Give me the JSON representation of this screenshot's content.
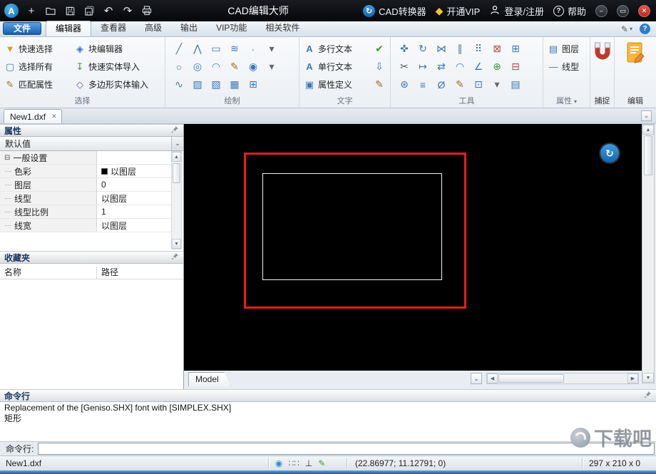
{
  "titlebar": {
    "title": "CAD编辑大师",
    "converter_label": "CAD转换器",
    "vip_label": "开通VIP",
    "login_label": "登录/注册",
    "help_label": "帮助"
  },
  "menu": {
    "file_label": "文件",
    "active_tab": "编辑器",
    "tabs": [
      {
        "name": "editor",
        "label": "编辑器"
      },
      {
        "name": "viewer",
        "label": "查看器"
      },
      {
        "name": "advanced",
        "label": "高级"
      },
      {
        "name": "output",
        "label": "输出"
      },
      {
        "name": "vip-features",
        "label": "VIP功能"
      },
      {
        "name": "related-software",
        "label": "相关软件"
      }
    ]
  },
  "ribbon": {
    "selection": {
      "label": "选择",
      "columns": [
        [
          {
            "name": "quick-select-button",
            "icon": "funnel-icon",
            "glyph": "▼",
            "color": "#d99c2b",
            "label": "快速选择"
          },
          {
            "name": "select-all-button",
            "icon": "selection-box-icon",
            "glyph": "▢",
            "color": "#3a78b5",
            "label": "选择所有"
          },
          {
            "name": "match-properties-button",
            "icon": "brush-icon",
            "glyph": "✎",
            "color": "#a06b2a",
            "label": "匹配属性"
          }
        ],
        [
          {
            "name": "block-editor-button",
            "icon": "block-icon",
            "glyph": "◈",
            "color": "#3a78b5",
            "label": "块编辑器"
          },
          {
            "name": "quick-entity-import-button",
            "icon": "import-arrow-icon",
            "glyph": "↧",
            "color": "#3f9646",
            "label": "快速实体导入"
          },
          {
            "name": "polygon-entity-input-button",
            "icon": "polygon-icon",
            "glyph": "◇",
            "color": "#7a5ab5",
            "label": "多边形实体输入"
          }
        ]
      ]
    },
    "draw": {
      "label": "绘制",
      "grid": [
        [
          {
            "name": "line-icon",
            "glyph": "╱",
            "color": "#3a78b5"
          },
          {
            "name": "polyline-icon",
            "glyph": "⋀",
            "color": "#3a78b5"
          },
          {
            "name": "rectangle-icon",
            "glyph": "▭",
            "color": "#3a78b5"
          },
          {
            "name": "multiline-icon",
            "glyph": "≋",
            "color": "#3a78b5"
          },
          {
            "name": "point-icon",
            "glyph": "∙",
            "color": "#3a78b5"
          },
          {
            "name": "draw-more-icon",
            "glyph": "▾",
            "color": "#666"
          }
        ],
        [
          {
            "name": "circle-icon",
            "glyph": "○",
            "color": "#3a78b5"
          },
          {
            "name": "ellipse-icon",
            "glyph": "◎",
            "color": "#3a78b5"
          },
          {
            "name": "arc-icon",
            "glyph": "◠",
            "color": "#3a78b5"
          },
          {
            "name": "sketch-icon",
            "glyph": "✎",
            "color": "#a06b2a"
          },
          {
            "name": "donut-icon",
            "glyph": "◉",
            "color": "#3a78b5"
          },
          {
            "name": "circle-more-icon",
            "glyph": "▾",
            "color": "#666"
          }
        ],
        [
          {
            "name": "spline-icon",
            "glyph": "∿",
            "color": "#3a78b5"
          },
          {
            "name": "hatch-icon",
            "glyph": "▨",
            "color": "#3a78b5"
          },
          {
            "name": "gradient-icon",
            "glyph": "▧",
            "color": "#3a78b5"
          },
          {
            "name": "boundary-icon",
            "glyph": "▦",
            "color": "#3a78b5"
          },
          {
            "name": "table-icon",
            "glyph": "⊞",
            "color": "#3a78b5"
          }
        ]
      ]
    },
    "text": {
      "label": "文字",
      "rows": [
        {
          "name": "mtext-button",
          "label": "多行文本",
          "glyph": "A",
          "color": "#3a78b5",
          "extra": {
            "name": "spellcheck-icon",
            "glyph": "✔",
            "color": "#3a9a3a"
          }
        },
        {
          "name": "single-text-button",
          "label": "单行文本",
          "glyph": "A",
          "color": "#3a78b5",
          "extra": {
            "name": "text-style-icon",
            "glyph": "⇩",
            "color": "#3a78b5"
          }
        },
        {
          "name": "attribute-define-button",
          "label": "属性定义",
          "glyph": "▣",
          "color": "#3a78b5",
          "extra": {
            "name": "attribute-edit-icon",
            "glyph": "✎",
            "color": "#a06b2a"
          }
        }
      ]
    },
    "tools": {
      "label": "工具",
      "grid": [
        [
          {
            "name": "move-icon",
            "glyph": "✜",
            "color": "#3a78b5"
          },
          {
            "name": "rotate-icon",
            "glyph": "↻",
            "color": "#3a78b5"
          },
          {
            "name": "mirror-icon",
            "glyph": "⋈",
            "color": "#3a78b5"
          },
          {
            "name": "offset-icon",
            "glyph": "∥",
            "color": "#3a78b5"
          },
          {
            "name": "array-icon",
            "glyph": "⠿",
            "color": "#3a78b5"
          },
          {
            "name": "erase-icon",
            "glyph": "⊠",
            "color": "#b54a4a"
          },
          {
            "name": "copy-icon",
            "glyph": "⊞",
            "color": "#3a78b5"
          }
        ],
        [
          {
            "name": "trim-icon",
            "glyph": "✂",
            "color": "#555555"
          },
          {
            "name": "extend-icon",
            "glyph": "↦",
            "color": "#3a78b5"
          },
          {
            "name": "stretch-icon",
            "glyph": "⇄",
            "color": "#3a78b5"
          },
          {
            "name": "fillet-icon",
            "glyph": "◠",
            "color": "#3a78b5"
          },
          {
            "name": "chamfer-icon",
            "glyph": "∠",
            "color": "#3a78b5"
          },
          {
            "name": "join-icon",
            "glyph": "⊕",
            "color": "#3f9646"
          },
          {
            "name": "break-icon",
            "glyph": "⊟",
            "color": "#b54a4a"
          }
        ],
        [
          {
            "name": "explode-icon",
            "glyph": "⊛",
            "color": "#3a78b5"
          },
          {
            "name": "align-icon",
            "glyph": "≡",
            "color": "#3a78b5"
          },
          {
            "name": "measure-icon",
            "glyph": "Ø",
            "color": "#3a78b5"
          },
          {
            "name": "polyline-edit-icon",
            "glyph": "✎",
            "color": "#a06b2a"
          },
          {
            "name": "scale-icon",
            "glyph": "⊡",
            "color": "#3a78b5"
          },
          {
            "name": "tools-more-icon",
            "glyph": "▾",
            "color": "#666"
          },
          {
            "name": "layers-tool-icon",
            "glyph": "▤",
            "color": "#3a78b5"
          }
        ]
      ]
    },
    "props": {
      "label": "属性",
      "rows": [
        {
          "name": "layers-button",
          "label": "图层",
          "glyph": "▤",
          "color": "#3a78b5"
        },
        {
          "name": "linetype-button",
          "label": "线型",
          "glyph": "―",
          "color": "#3a78b5"
        }
      ]
    },
    "snap_label": "捕捉",
    "edit_label": "编辑"
  },
  "docbar": {
    "tab": "New1.dxf"
  },
  "properties_panel": {
    "title": "属性",
    "selector_value": "默认值",
    "group_row": "一般设置",
    "rows": [
      {
        "name": "color",
        "label": "色彩",
        "value": "以图层",
        "swatch": "#000000"
      },
      {
        "name": "layer",
        "label": "图层",
        "value": "0"
      },
      {
        "name": "linetype",
        "label": "线型",
        "value": "以图层"
      },
      {
        "name": "linetype-scale",
        "label": "线型比例",
        "value": "1"
      },
      {
        "name": "lineweight",
        "label": "线宽",
        "value": "以图层"
      }
    ]
  },
  "favorites_panel": {
    "title": "收藏夹",
    "name_col": "名称",
    "path_col": "路径"
  },
  "canvas": {
    "model_tab_label": "Model",
    "background": "#000000",
    "red_rect_color": "#ee1c1c",
    "white_rect_color": "#f2f2f2"
  },
  "command_panel": {
    "title": "命令行",
    "history": [
      "Replacement of the [Geniso.SHX] font with [SIMPLEX.SHX]",
      "矩形"
    ],
    "prompt_label": "命令行:",
    "input_value": ""
  },
  "statusbar": {
    "filename": "New1.dxf",
    "coordinates": "(22.86977; 11.12791; 0)",
    "dimensions": "297 x 210 x 0",
    "toggles": [
      {
        "name": "snap-toggle",
        "glyph": "◉",
        "color": "#2a8fd0"
      },
      {
        "name": "grid-toggle",
        "glyph": "∷∷",
        "color": "#667"
      },
      {
        "name": "ortho-toggle",
        "glyph": "⊥",
        "color": "#333"
      },
      {
        "name": "osnap-toggle",
        "glyph": "✎",
        "color": "#3a9a3a"
      }
    ]
  },
  "watermark": "下载吧",
  "icons": {
    "logo_glyph": "A",
    "new": "+",
    "undo": "↶",
    "redo": "↷",
    "minimize": "–",
    "maximize": "▭",
    "close": "✕",
    "vip": "◆",
    "help": "?",
    "converter": "↻",
    "caret": "▾",
    "chevron": "⌄",
    "collapse": "⊟",
    "tab_close": "✕",
    "up": "▲",
    "down": "▼",
    "left": "◀",
    "right": "▶",
    "canvas_logo": "↻",
    "customize": "✎"
  }
}
